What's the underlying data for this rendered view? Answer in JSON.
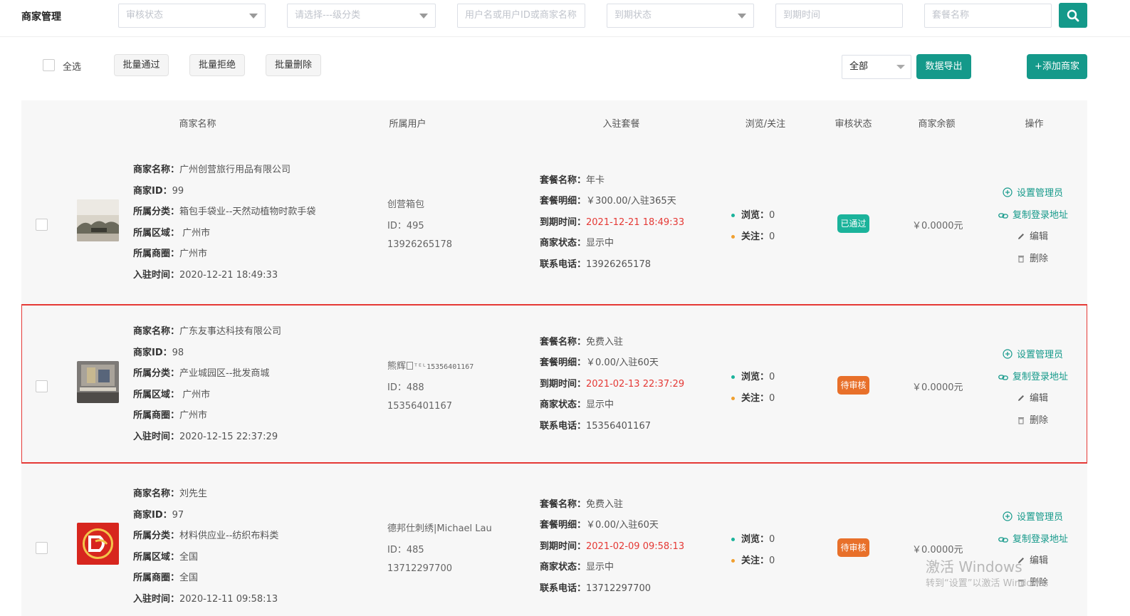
{
  "page": {
    "title": "商家管理"
  },
  "filters": {
    "audit_status": "审核状态",
    "category": "请选择---级分类",
    "keyword": "用户名或用户ID或商家名称",
    "expire_status": "到期状态",
    "expire_time": "到期时间",
    "package_name": "套餐名称"
  },
  "toolbar": {
    "select_all": "全选",
    "batch_approve": "批量通过",
    "batch_reject": "批量拒绝",
    "batch_delete": "批量删除",
    "scope_select": "全部",
    "export": "数据导出",
    "add_merchant": "+添加商家"
  },
  "columns": [
    "商家名称",
    "所属用户",
    "入驻套餐",
    "浏览/关注",
    "审核状态",
    "商家余额",
    "操作"
  ],
  "labels": {
    "name": "商家名称：",
    "id": "商家ID：",
    "category": "所属分类：",
    "region": "所属区域：",
    "district": "所属商圈：",
    "join_time": "入驻时间：",
    "pkg_name": "套餐名称：",
    "pkg_detail": "套餐明细：",
    "expire": "到期时间：",
    "status": "商家状态：",
    "phone": "联系电话：",
    "views": "浏览：",
    "follows": "关注："
  },
  "operations": {
    "set_admin": "设置管理员",
    "copy_login": "复制登录地址",
    "edit": "编辑",
    "delete": "删除"
  },
  "colors": {
    "accent": "#14998a",
    "approved": "#1bb39b",
    "pending": "#e8702a",
    "expire_red": "#e53935",
    "highlight_border": "#e53935"
  },
  "rows": [
    {
      "name": "广州创营旅行用品有限公司",
      "id": "99",
      "category": "箱包手袋业--天然动植物时款手袋",
      "region": "广州市",
      "district": "广州市",
      "join_time": "2020-12-21 18:49:33",
      "user_name": "创营箱包",
      "user_id": "ID：495",
      "user_phone": "13926265178",
      "pkg_name": "年卡",
      "pkg_detail": "￥300.00/入驻365天",
      "expire": "2021-12-21 18:49:33",
      "status": "显示中",
      "phone": "13926265178",
      "views": "0",
      "follows": "0",
      "audit": "已通过",
      "balance": "￥0.0000元"
    },
    {
      "name": "广东友事达科技有限公司",
      "id": "98",
      "category": "产业城园区--批发商城",
      "region": "广州市",
      "district": "广州市",
      "join_time": "2020-12-15 22:37:29",
      "user_name": "熊辉",
      "user_name_suffix": "ᵀᴱᴸ15356401167",
      "user_id": "ID：488",
      "user_phone": "15356401167",
      "pkg_name": "免费入驻",
      "pkg_detail": "￥0.00/入驻60天",
      "expire": "2021-02-13 22:37:29",
      "status": "显示中",
      "phone": "15356401167",
      "views": "0",
      "follows": "0",
      "audit": "待审核",
      "balance": "￥0.0000元"
    },
    {
      "name": "刘先生",
      "id": "97",
      "category": "材料供应业--纺织布料类",
      "region": "全国",
      "district": "全国",
      "join_time": "2020-12-11 09:58:13",
      "user_name": "德邦仕刺绣|Michael Lau",
      "user_id": "ID：485",
      "user_phone": "13712297700",
      "pkg_name": "免费入驻",
      "pkg_detail": "￥0.00/入驻60天",
      "expire": "2021-02-09 09:58:13",
      "status": "显示中",
      "phone": "13712297700",
      "views": "0",
      "follows": "0",
      "audit": "待审核",
      "balance": "￥0.0000元"
    }
  ],
  "watermark": {
    "line1": "激活 Windows",
    "line2": "转到“设置”以激活 Windows。"
  }
}
